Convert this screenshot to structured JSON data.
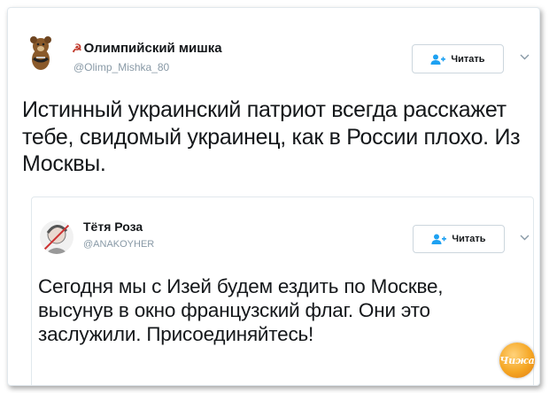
{
  "tweet": {
    "author_name": "Олимпийский мишка",
    "author_handle": "@Olimp_Mishka_80",
    "follow_label": "Читать",
    "text": "Истинный украинский патриот всегда расскажет тебе, свидомый украинец, как в России плохо. Из Москвы."
  },
  "quoted": {
    "author_name": "Тётя Роза",
    "author_handle": "@ANAKOYHER",
    "follow_label": "Читать",
    "text": "Сегодня мы с Изей будем ездить по Москве, высунув в окно французский флаг. Они это заслужили. Присоединяйтесь!"
  },
  "watermark": "Чижа",
  "icons": {
    "follow": "add-user-icon",
    "more": "chevron-down-icon",
    "sickle": "hammer-sickle-icon"
  },
  "colors": {
    "follow_icon": "#1da1f2",
    "handle": "#8899a6",
    "text": "#14171a"
  }
}
